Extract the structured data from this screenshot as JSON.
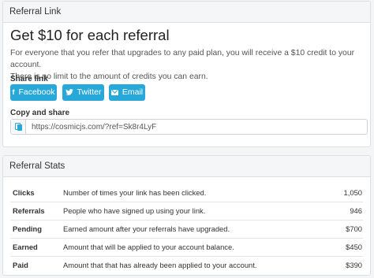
{
  "referral_link": {
    "header": "Referral Link",
    "headline": "Get $10 for each referral",
    "description_lines": [
      "For everyone that you refer that upgrades to any paid plan, you will receive a $10 credit to your account.",
      "There is no limit to the amount of credits you can earn."
    ],
    "share_label": "Share link",
    "buttons": {
      "facebook": {
        "icon": "f",
        "label": "Facebook"
      },
      "twitter": {
        "label": "Twitter"
      },
      "email": {
        "label": "Email"
      }
    },
    "copy_label": "Copy and share",
    "referral_url": "https://cosmicjs.com/?ref=Sk8r4LyF"
  },
  "referral_stats": {
    "header": "Referral Stats",
    "rows": [
      {
        "label": "Clicks",
        "description": "Number of times your link has been clicked.",
        "value": "1,050"
      },
      {
        "label": "Referrals",
        "description": "People who have signed up using your link.",
        "value": "946"
      },
      {
        "label": "Pending",
        "description": "Earned amount after your referrals have upgraded.",
        "value": "$700"
      },
      {
        "label": "Earned",
        "description": "Amount that will be applied to your account balance.",
        "value": "$450"
      },
      {
        "label": "Paid",
        "description": "Amount that that has already been applied to your account.",
        "value": "$390"
      }
    ]
  },
  "colors": {
    "accent": "#28a8d8",
    "card_header_bg": "#f5f6f8",
    "page_bg": "#f4f5f7"
  }
}
